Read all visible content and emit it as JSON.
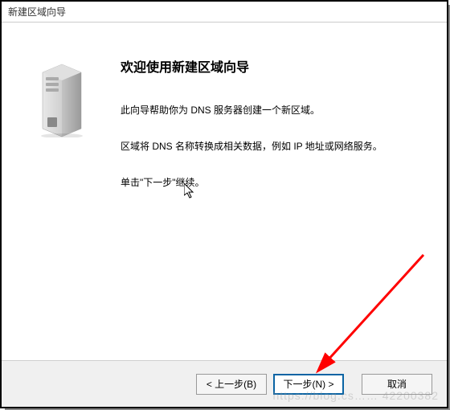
{
  "titlebar": {
    "text": "新建区域向导"
  },
  "heading": "欢迎使用新建区域向导",
  "paragraphs": {
    "p1": "此向导帮助你为 DNS 服务器创建一个新区域。",
    "p2": "区域将 DNS 名称转换成相关数据，例如 IP 地址或网络服务。",
    "p3": "单击\"下一步\"继续。"
  },
  "buttons": {
    "back": "< 上一步(B)",
    "next": "下一步(N) >",
    "cancel": "取消"
  },
  "icons": {
    "server": "server-tower-icon",
    "cursor": "mouse-cursor-icon",
    "arrow": "red-annotation-arrow"
  },
  "watermark": "https://blog.cs…… 42200382"
}
